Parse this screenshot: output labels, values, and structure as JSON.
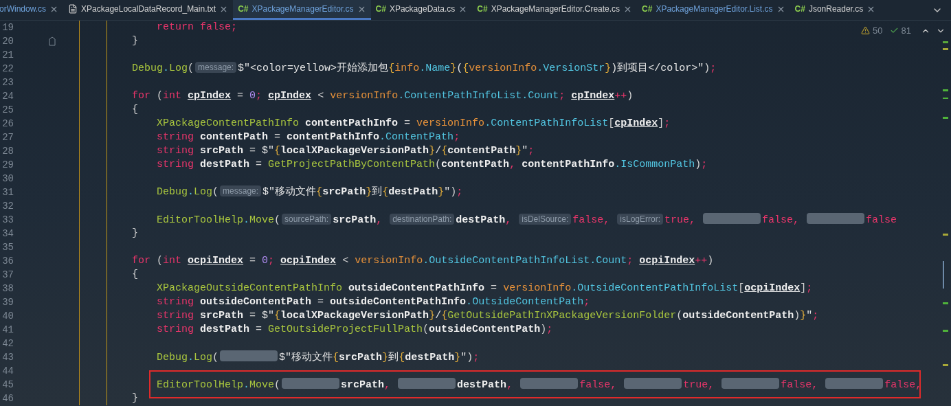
{
  "tabs": [
    {
      "label": "orWindow.cs",
      "kind": "plain",
      "selected": false,
      "modified": true
    },
    {
      "label": "XPackageLocalDataRecord_Main.txt",
      "kind": "txt",
      "selected": false,
      "modified": false
    },
    {
      "label": "XPackageManagerEditor.cs",
      "kind": "cs",
      "badge": "C#",
      "selected": true,
      "modified": true
    },
    {
      "label": "XPackageData.cs",
      "kind": "cs",
      "badge": "C#",
      "selected": false,
      "modified": false
    },
    {
      "label": "XPackageManagerEditor.Create.cs",
      "kind": "cs",
      "badge": "C#",
      "selected": false,
      "modified": false
    },
    {
      "label": "XPackageManagerEditor.List.cs",
      "kind": "cs",
      "badge": "C#",
      "selected": false,
      "modified": true
    },
    {
      "label": "JsonReader.cs",
      "kind": "cs",
      "badge": "C#",
      "selected": false,
      "modified": false
    }
  ],
  "inspection": {
    "warnings": "50",
    "passed": "81"
  },
  "lines": [
    {
      "number": "19",
      "fold": false,
      "annotated": false,
      "tokens": [
        {
          "text": "    return false",
          "kind": "kw"
        },
        {
          "text": ";",
          "kind": "semi"
        }
      ]
    },
    {
      "number": "20",
      "fold": true,
      "annotated": false,
      "tokens": [
        {
          "text": "}",
          "kind": "plain"
        }
      ]
    },
    {
      "number": "21",
      "fold": false,
      "annotated": false
    },
    {
      "number": "22",
      "fold": false,
      "annotated": false,
      "tokens": [
        {
          "text": "Debug",
          "kind": "fn"
        },
        {
          "text": ".",
          "kind": "prop"
        },
        {
          "text": "Log",
          "kind": "fn"
        },
        {
          "text": "(",
          "kind": "plain"
        },
        {
          "text": "message:",
          "kind": "hint"
        },
        {
          "text": "$\"<color=yellow>开始添加包",
          "kind": "str"
        },
        {
          "text": "{",
          "kind": "brace"
        },
        {
          "text": "info",
          "kind": "field"
        },
        {
          "text": ".",
          "kind": "prop"
        },
        {
          "text": "Name",
          "kind": "prop"
        },
        {
          "text": "}",
          "kind": "brace"
        },
        {
          "text": "(",
          "kind": "str"
        },
        {
          "text": "{",
          "kind": "brace"
        },
        {
          "text": "versionInfo",
          "kind": "field"
        },
        {
          "text": ".",
          "kind": "prop"
        },
        {
          "text": "VersionStr",
          "kind": "prop"
        },
        {
          "text": "}",
          "kind": "brace"
        },
        {
          "text": ")到项目</color>\"",
          "kind": "str"
        },
        {
          "text": ")",
          "kind": "plain"
        },
        {
          "text": ";",
          "kind": "semi"
        }
      ]
    },
    {
      "number": "23",
      "fold": false,
      "annotated": false
    },
    {
      "number": "24",
      "fold": false,
      "annotated": false,
      "tokens": [
        {
          "text": "for",
          "kind": "kw"
        },
        {
          "text": " (",
          "kind": "plain"
        },
        {
          "text": "int ",
          "kind": "kw"
        },
        {
          "text": "cpIndex",
          "kind": "local-u"
        },
        {
          "text": " = ",
          "kind": "plain"
        },
        {
          "text": "0",
          "kind": "num"
        },
        {
          "text": "; ",
          "kind": "semi"
        },
        {
          "text": "cpIndex",
          "kind": "local-u"
        },
        {
          "text": " < ",
          "kind": "plain"
        },
        {
          "text": "versionInfo",
          "kind": "field"
        },
        {
          "text": ".",
          "kind": "prop"
        },
        {
          "text": "ContentPathInfoList",
          "kind": "prop"
        },
        {
          "text": ".",
          "kind": "prop"
        },
        {
          "text": "Count",
          "kind": "prop"
        },
        {
          "text": "; ",
          "kind": "semi"
        },
        {
          "text": "cpIndex",
          "kind": "local-u"
        },
        {
          "text": "++",
          "kind": "semi"
        },
        {
          "text": ")",
          "kind": "plain"
        }
      ]
    },
    {
      "number": "25",
      "fold": false,
      "annotated": false,
      "tokens": [
        {
          "text": "{",
          "kind": "plain"
        }
      ]
    },
    {
      "number": "26",
      "fold": false,
      "annotated": false,
      "tokens": [
        {
          "text": "    XPackageContentPathInfo",
          "kind": "fn"
        },
        {
          "text": " contentPathInfo",
          "kind": "local"
        },
        {
          "text": " = ",
          "kind": "plain"
        },
        {
          "text": "versionInfo",
          "kind": "field"
        },
        {
          "text": ".",
          "kind": "prop"
        },
        {
          "text": "ContentPathInfoList",
          "kind": "prop"
        },
        {
          "text": "[",
          "kind": "plain"
        },
        {
          "text": "cpIndex",
          "kind": "local-u"
        },
        {
          "text": "]",
          "kind": "plain"
        },
        {
          "text": ";",
          "kind": "semi"
        }
      ]
    },
    {
      "number": "27",
      "fold": false,
      "annotated": false,
      "tokens": [
        {
          "text": "    string",
          "kind": "kw"
        },
        {
          "text": " contentPath",
          "kind": "local"
        },
        {
          "text": " = ",
          "kind": "plain"
        },
        {
          "text": "contentPathInfo",
          "kind": "local"
        },
        {
          "text": ".",
          "kind": "prop"
        },
        {
          "text": "ContentPath",
          "kind": "prop"
        },
        {
          "text": ";",
          "kind": "semi"
        }
      ]
    },
    {
      "number": "28",
      "fold": false,
      "annotated": false,
      "tokens": [
        {
          "text": "    string",
          "kind": "kw"
        },
        {
          "text": " srcPath",
          "kind": "local"
        },
        {
          "text": " = ",
          "kind": "plain"
        },
        {
          "text": "$\"",
          "kind": "str"
        },
        {
          "text": "{",
          "kind": "brace"
        },
        {
          "text": "localXPackageVersionPath",
          "kind": "local"
        },
        {
          "text": "}",
          "kind": "brace"
        },
        {
          "text": "/",
          "kind": "str"
        },
        {
          "text": "{",
          "kind": "brace"
        },
        {
          "text": "contentPath",
          "kind": "local"
        },
        {
          "text": "}",
          "kind": "brace"
        },
        {
          "text": "\"",
          "kind": "str"
        },
        {
          "text": ";",
          "kind": "semi"
        }
      ]
    },
    {
      "number": "29",
      "fold": false,
      "annotated": false,
      "tokens": [
        {
          "text": "    string",
          "kind": "kw"
        },
        {
          "text": " destPath",
          "kind": "local"
        },
        {
          "text": " = ",
          "kind": "plain"
        },
        {
          "text": "GetProjectPathByContentPath",
          "kind": "fn"
        },
        {
          "text": "(",
          "kind": "plain"
        },
        {
          "text": "contentPath",
          "kind": "local"
        },
        {
          "text": ", ",
          "kind": "semi"
        },
        {
          "text": "contentPathInfo",
          "kind": "local"
        },
        {
          "text": ".",
          "kind": "prop"
        },
        {
          "text": "IsCommonPath",
          "kind": "prop"
        },
        {
          "text": ")",
          "kind": "plain"
        },
        {
          "text": ";",
          "kind": "semi"
        }
      ]
    },
    {
      "number": "30",
      "fold": false,
      "annotated": false
    },
    {
      "number": "31",
      "fold": false,
      "annotated": false,
      "tokens": [
        {
          "text": "    Debug",
          "kind": "fn"
        },
        {
          "text": ".",
          "kind": "prop"
        },
        {
          "text": "Log",
          "kind": "fn"
        },
        {
          "text": "(",
          "kind": "plain"
        },
        {
          "text": "message:",
          "kind": "hint"
        },
        {
          "text": "$\"移动文件",
          "kind": "str"
        },
        {
          "text": "{",
          "kind": "brace"
        },
        {
          "text": "srcPath",
          "kind": "local"
        },
        {
          "text": "}",
          "kind": "brace"
        },
        {
          "text": "到",
          "kind": "str"
        },
        {
          "text": "{",
          "kind": "brace"
        },
        {
          "text": "destPath",
          "kind": "local"
        },
        {
          "text": "}",
          "kind": "brace"
        },
        {
          "text": "\"",
          "kind": "str"
        },
        {
          "text": ")",
          "kind": "plain"
        },
        {
          "text": ";",
          "kind": "semi"
        }
      ]
    },
    {
      "number": "32",
      "fold": false,
      "annotated": false
    },
    {
      "number": "33",
      "fold": false,
      "annotated": false,
      "tokens": [
        {
          "text": "    EditorToolHelp",
          "kind": "fn"
        },
        {
          "text": ".",
          "kind": "prop"
        },
        {
          "text": "Move",
          "kind": "fn"
        },
        {
          "text": "(",
          "kind": "plain"
        },
        {
          "text": "sourcePath:",
          "kind": "hint"
        },
        {
          "text": "srcPath",
          "kind": "local"
        },
        {
          "text": ", ",
          "kind": "semi"
        },
        {
          "text": "destinationPath:",
          "kind": "hint"
        },
        {
          "text": "destPath",
          "kind": "local"
        },
        {
          "text": ", ",
          "kind": "semi"
        },
        {
          "text": "isDelSource:",
          "kind": "hint"
        },
        {
          "text": "false",
          "kind": "kw"
        },
        {
          "text": ", ",
          "kind": "semi"
        },
        {
          "text": "isLogError:",
          "kind": "hint"
        },
        {
          "text": "true",
          "kind": "kw"
        },
        {
          "text": ", ",
          "kind": "semi"
        },
        {
          "kind": "blurred-hint"
        },
        {
          "text": "false",
          "kind": "kw"
        },
        {
          "text": ", ",
          "kind": "semi"
        },
        {
          "kind": "blurred-hint"
        },
        {
          "text": "false",
          "kind": "kw"
        }
      ]
    },
    {
      "number": "34",
      "fold": false,
      "annotated": false,
      "tokens": [
        {
          "text": "}",
          "kind": "plain"
        }
      ]
    },
    {
      "number": "35",
      "fold": false,
      "annotated": false
    },
    {
      "number": "36",
      "fold": false,
      "annotated": false,
      "tokens": [
        {
          "text": "for",
          "kind": "kw"
        },
        {
          "text": " (",
          "kind": "plain"
        },
        {
          "text": "int ",
          "kind": "kw"
        },
        {
          "text": "ocpiIndex",
          "kind": "local-u"
        },
        {
          "text": " = ",
          "kind": "plain"
        },
        {
          "text": "0",
          "kind": "num"
        },
        {
          "text": "; ",
          "kind": "semi"
        },
        {
          "text": "ocpiIndex",
          "kind": "local-u"
        },
        {
          "text": " < ",
          "kind": "plain"
        },
        {
          "text": "versionInfo",
          "kind": "field"
        },
        {
          "text": ".",
          "kind": "prop"
        },
        {
          "text": "OutsideContentPathInfoList",
          "kind": "prop"
        },
        {
          "text": ".",
          "kind": "prop"
        },
        {
          "text": "Count",
          "kind": "prop"
        },
        {
          "text": "; ",
          "kind": "semi"
        },
        {
          "text": "ocpiIndex",
          "kind": "local-u"
        },
        {
          "text": "++",
          "kind": "semi"
        },
        {
          "text": ")",
          "kind": "plain"
        }
      ]
    },
    {
      "number": "37",
      "fold": false,
      "annotated": false,
      "tokens": [
        {
          "text": "{",
          "kind": "plain"
        }
      ]
    },
    {
      "number": "38",
      "fold": false,
      "annotated": false,
      "tokens": [
        {
          "text": "    XPackageOutsideContentPathInfo",
          "kind": "fn"
        },
        {
          "text": " outsideContentPathInfo",
          "kind": "local"
        },
        {
          "text": " = ",
          "kind": "plain"
        },
        {
          "text": "versionInfo",
          "kind": "field"
        },
        {
          "text": ".",
          "kind": "prop"
        },
        {
          "text": "OutsideContentPathInfoList",
          "kind": "prop"
        },
        {
          "text": "[",
          "kind": "plain"
        },
        {
          "text": "ocpiIndex",
          "kind": "local-u"
        },
        {
          "text": "]",
          "kind": "plain"
        },
        {
          "text": ";",
          "kind": "semi"
        }
      ]
    },
    {
      "number": "39",
      "fold": false,
      "annotated": false,
      "tokens": [
        {
          "text": "    string",
          "kind": "kw"
        },
        {
          "text": " outsideContentPath",
          "kind": "local"
        },
        {
          "text": " = ",
          "kind": "plain"
        },
        {
          "text": "outsideContentPathInfo",
          "kind": "local"
        },
        {
          "text": ".",
          "kind": "prop"
        },
        {
          "text": "OutsideContentPath",
          "kind": "prop"
        },
        {
          "text": ";",
          "kind": "semi"
        }
      ]
    },
    {
      "number": "40",
      "fold": false,
      "annotated": false,
      "tokens": [
        {
          "text": "    string",
          "kind": "kw"
        },
        {
          "text": " srcPath",
          "kind": "local"
        },
        {
          "text": " = ",
          "kind": "plain"
        },
        {
          "text": "$\"",
          "kind": "str"
        },
        {
          "text": "{",
          "kind": "brace"
        },
        {
          "text": "localXPackageVersionPath",
          "kind": "local"
        },
        {
          "text": "}",
          "kind": "brace"
        },
        {
          "text": "/",
          "kind": "str"
        },
        {
          "text": "{",
          "kind": "brace"
        },
        {
          "text": "GetOutsidePathInXPackageVersionFolder",
          "kind": "fn"
        },
        {
          "text": "(",
          "kind": "plain"
        },
        {
          "text": "outsideContentPath",
          "kind": "local"
        },
        {
          "text": ")",
          "kind": "plain"
        },
        {
          "text": "}",
          "kind": "brace"
        },
        {
          "text": "\"",
          "kind": "str"
        },
        {
          "text": ";",
          "kind": "semi"
        }
      ]
    },
    {
      "number": "41",
      "fold": false,
      "annotated": false,
      "tokens": [
        {
          "text": "    string",
          "kind": "kw"
        },
        {
          "text": " destPath",
          "kind": "local"
        },
        {
          "text": " = ",
          "kind": "plain"
        },
        {
          "text": "GetOutsideProjectFullPath",
          "kind": "fn"
        },
        {
          "text": "(",
          "kind": "plain"
        },
        {
          "text": "outsideContentPath",
          "kind": "local"
        },
        {
          "text": ")",
          "kind": "plain"
        },
        {
          "text": ";",
          "kind": "semi"
        }
      ]
    },
    {
      "number": "42",
      "fold": false,
      "annotated": false
    },
    {
      "number": "43",
      "fold": false,
      "annotated": false,
      "tokens": [
        {
          "text": "    Debug",
          "kind": "fn"
        },
        {
          "text": ".",
          "kind": "prop"
        },
        {
          "text": "Log",
          "kind": "fn"
        },
        {
          "text": "(",
          "kind": "plain"
        },
        {
          "kind": "blurred-hint"
        },
        {
          "text": "$\"移动文件",
          "kind": "str"
        },
        {
          "text": "{",
          "kind": "brace"
        },
        {
          "text": "srcPath",
          "kind": "local"
        },
        {
          "text": "}",
          "kind": "brace"
        },
        {
          "text": "到",
          "kind": "str"
        },
        {
          "text": "{",
          "kind": "brace"
        },
        {
          "text": "destPath",
          "kind": "local"
        },
        {
          "text": "}",
          "kind": "brace"
        },
        {
          "text": "\"",
          "kind": "str"
        },
        {
          "text": ")",
          "kind": "plain"
        },
        {
          "text": ";",
          "kind": "semi"
        }
      ]
    },
    {
      "number": "44",
      "fold": false,
      "annotated": false
    },
    {
      "number": "45",
      "fold": false,
      "annotated": true,
      "tokens": [
        {
          "text": "    EditorToolHelp",
          "kind": "fn"
        },
        {
          "text": ".",
          "kind": "prop"
        },
        {
          "text": "Move",
          "kind": "fn"
        },
        {
          "text": "(",
          "kind": "plain"
        },
        {
          "kind": "blurred-hint"
        },
        {
          "text": "srcPath",
          "kind": "local"
        },
        {
          "text": ", ",
          "kind": "semi"
        },
        {
          "kind": "blurred-hint"
        },
        {
          "text": "destPath",
          "kind": "local"
        },
        {
          "text": ", ",
          "kind": "semi"
        },
        {
          "kind": "blurred-hint"
        },
        {
          "text": "false",
          "kind": "kw"
        },
        {
          "text": ", ",
          "kind": "semi"
        },
        {
          "kind": "blurred-hint"
        },
        {
          "text": "true",
          "kind": "kw"
        },
        {
          "text": ", ",
          "kind": "semi"
        },
        {
          "kind": "blurred-hint"
        },
        {
          "text": "false",
          "kind": "kw"
        },
        {
          "text": ", ",
          "kind": "semi"
        },
        {
          "kind": "blurred-hint"
        },
        {
          "text": "false,",
          "kind": "kw"
        }
      ]
    },
    {
      "number": "46",
      "fold": false,
      "annotated": false,
      "tokens": [
        {
          "text": "}",
          "kind": "plain"
        }
      ]
    }
  ]
}
